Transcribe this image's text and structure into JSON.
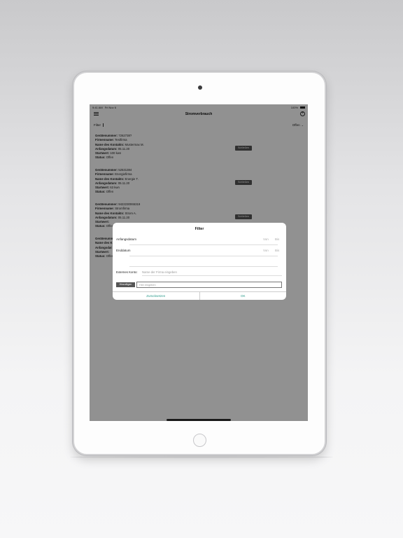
{
  "status_bar": {
    "time": "9:41 AM",
    "date": "Fri Nov 6",
    "battery": "100%"
  },
  "nav": {
    "title": "Stromverbrauch"
  },
  "filter_bar": {
    "label": "Filter",
    "status": "Offen"
  },
  "records": [
    {
      "lines": [
        {
          "label": "Gerätenummer:",
          "value": "7262738?"
        },
        {
          "label": "Firmenname:",
          "value": "Testfirma"
        },
        {
          "label": "Name des Kontakts:",
          "value": "Mustermax M."
        },
        {
          "label": "Anfangsdatum:",
          "value": "05.11.20"
        },
        {
          "label": "Startwert:",
          "value": "100 kwn"
        },
        {
          "label": "Status:",
          "value": "Offen"
        }
      ],
      "button": "Schließen"
    },
    {
      "lines": [
        {
          "label": "Gerätenummer:",
          "value": "52531384"
        },
        {
          "label": "Firmenname:",
          "value": "Energiefirma"
        },
        {
          "label": "Name des Kontakts:",
          "value": "Energie T."
        },
        {
          "label": "Anfangsdatum:",
          "value": "05.11.20"
        },
        {
          "label": "Startwert:",
          "value": "63 kwn"
        },
        {
          "label": "Status:",
          "value": "Offen"
        }
      ],
      "button": "Schließen"
    },
    {
      "lines": [
        {
          "label": "Gerätenummer:",
          "value": "9422230065319"
        },
        {
          "label": "Firmenname:",
          "value": "Stromfirma"
        },
        {
          "label": "Name des Kontakts:",
          "value": "Strom A."
        },
        {
          "label": "Anfangsdatum:",
          "value": "05.11.20"
        },
        {
          "label": "Startwert:",
          "value": ""
        },
        {
          "label": "Status:",
          "value": "Offen"
        }
      ],
      "button": "Schließen"
    },
    {
      "lines": [
        {
          "label": "Gerätenummer:",
          "value": ""
        },
        {
          "label": "Name des K",
          "value": ""
        },
        {
          "label": "Anfangsdat",
          "value": ""
        },
        {
          "label": "Startwert:",
          "value": ""
        },
        {
          "label": "Status:",
          "value": "Offen"
        }
      ],
      "button": ""
    }
  ],
  "dialog": {
    "title": "Filter",
    "start_label": "Anfangsdatum",
    "end_label": "Enddatum",
    "von": "Von",
    "bis": "Bis",
    "ext_label": "Externes Konto:",
    "ext_placeholder": "Name der Firma eingeben",
    "add_button": "Hinzufügen",
    "input_placeholder": "Hier eingeben",
    "reset_button": "Zurücksetzen",
    "ok_button": "OK"
  }
}
